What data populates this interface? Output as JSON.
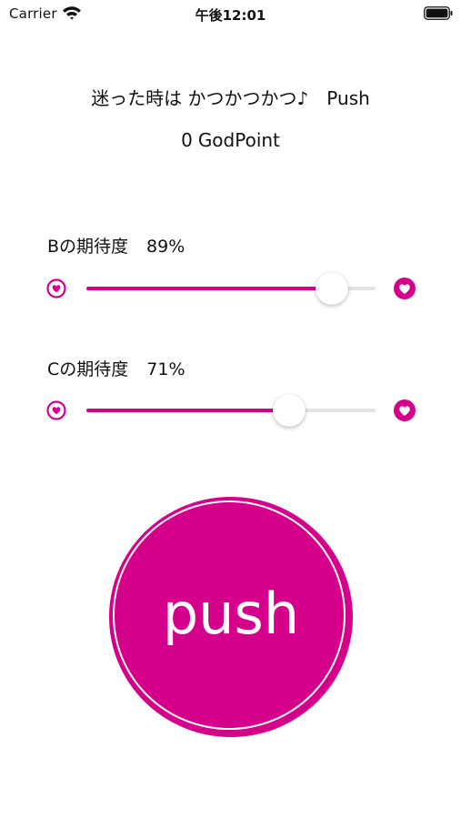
{
  "theme": {
    "accent": "#d4008a",
    "track_bg": "#e4e4e4"
  },
  "status_bar": {
    "carrier": "Carrier",
    "time": "午後12:01",
    "icons": [
      "wifi-icon",
      "battery-icon"
    ]
  },
  "header": {
    "subtitle": "迷った時は かつかつかつ♪　Push",
    "godpoint_value": "0",
    "godpoint_label": "GodPoint"
  },
  "sliders": [
    {
      "name": "B",
      "label": "Bの期待度",
      "percent_text": "89%",
      "value": 0.85,
      "min_icon": "heart-outline-icon",
      "max_icon": "heart-filled-icon"
    },
    {
      "name": "C",
      "label": "Cの期待度",
      "percent_text": "71%",
      "value": 0.7,
      "min_icon": "heart-outline-icon",
      "max_icon": "heart-filled-icon"
    }
  ],
  "push_button": {
    "label": "push"
  }
}
